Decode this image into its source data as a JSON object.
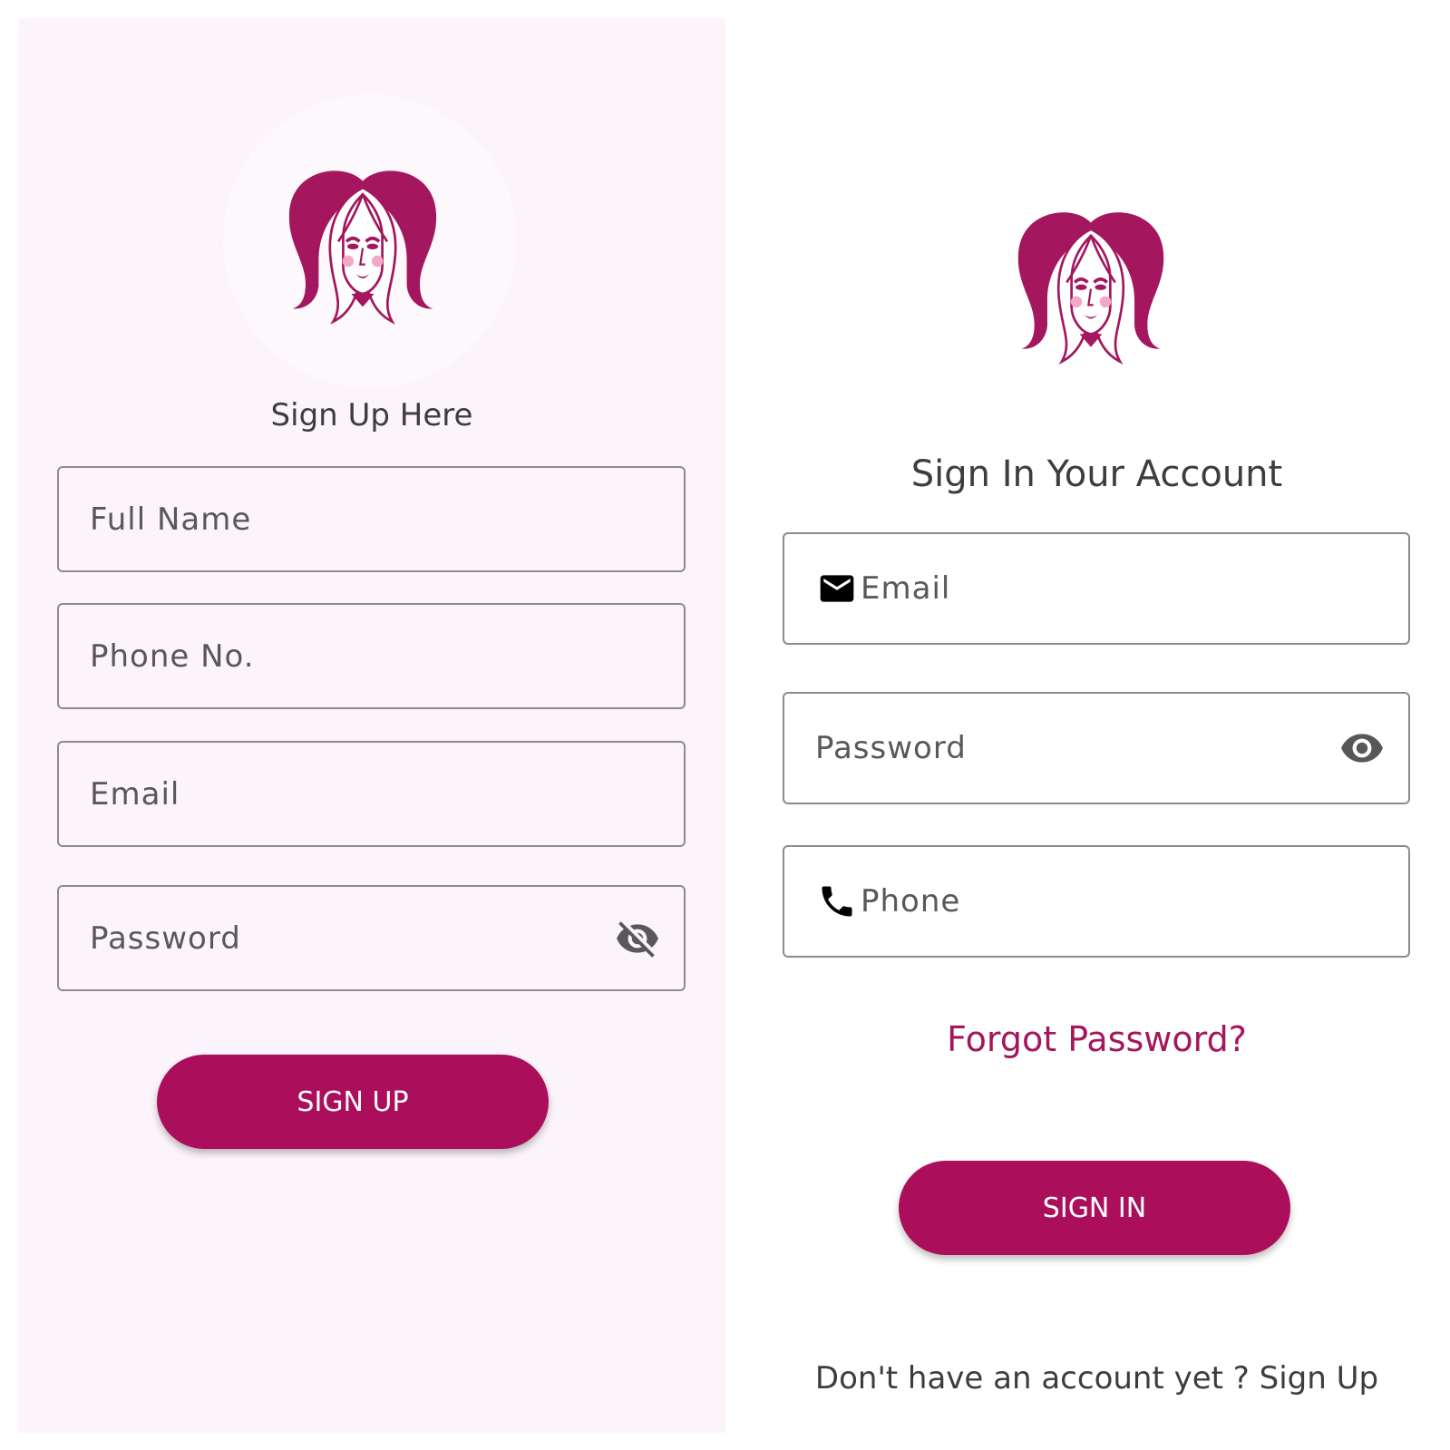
{
  "brand": {
    "accent": "#ab0f5c",
    "panel_bg": "#fcf4fb",
    "logo_primary": "#a4165e",
    "logo_blush": "#f3a8c8"
  },
  "signup": {
    "title": "Sign Up Here",
    "fields": {
      "full_name": {
        "placeholder": "Full Name"
      },
      "phone": {
        "placeholder": "Phone No."
      },
      "email": {
        "placeholder": "Email"
      },
      "password": {
        "placeholder": "Password",
        "trailing_icon": "visibility-off-icon"
      }
    },
    "button_label": "SIGN UP"
  },
  "signin": {
    "title": "Sign In Your Account",
    "fields": {
      "email": {
        "placeholder": "Email",
        "leading_icon": "mail-icon"
      },
      "password": {
        "placeholder": "Password",
        "trailing_icon": "eye-icon"
      },
      "phone": {
        "placeholder": "Phone",
        "leading_icon": "phone-icon"
      }
    },
    "forgot_label": "Forgot Password?",
    "button_label": "SIGN IN",
    "no_account_text": "Don't have an account yet ?",
    "signup_link_label": "Sign Up"
  }
}
